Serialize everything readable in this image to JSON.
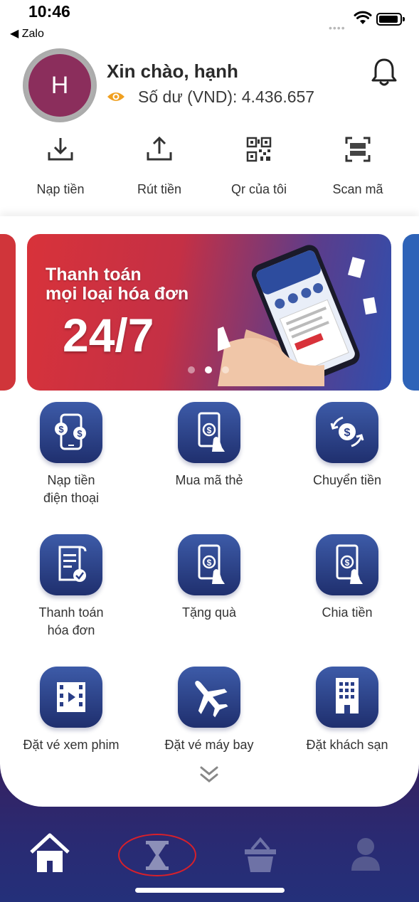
{
  "status_bar": {
    "time": "10:46",
    "back_app": "◀ Zalo",
    "signal_dots": "••••"
  },
  "profile": {
    "avatar_initial": "H",
    "greeting": "Xin chào, hạnh",
    "balance": "Số dư (VND): 4.436.657"
  },
  "quick_actions": [
    {
      "label": "Nạp tiền",
      "icon": "download-icon"
    },
    {
      "label": "Rút tiền",
      "icon": "upload-icon"
    },
    {
      "label": "Qr của tôi",
      "icon": "qr-code-icon"
    },
    {
      "label": "Scan mã",
      "icon": "scan-icon"
    }
  ],
  "banner": {
    "title_line1": "Thanh toán",
    "title_line2": "mọi loại hóa đơn",
    "big_text": "24/7",
    "active_index": 1,
    "count": 3
  },
  "services": [
    {
      "label": "Nạp tiền\nđiện thoại",
      "icon": "phone-topup-icon"
    },
    {
      "label": "Mua mã thẻ",
      "icon": "card-code-icon"
    },
    {
      "label": "Chuyển tiền",
      "icon": "transfer-icon"
    },
    {
      "label": "Thanh toán\nhóa đơn",
      "icon": "bill-icon"
    },
    {
      "label": "Tặng quà",
      "icon": "gift-money-icon"
    },
    {
      "label": "Chia tiền",
      "icon": "split-money-icon"
    },
    {
      "label": "Đặt vé xem phim",
      "icon": "movie-ticket-icon"
    },
    {
      "label": "Đặt vé máy bay",
      "icon": "airplane-icon"
    },
    {
      "label": "Đặt khách sạn",
      "icon": "hotel-icon"
    }
  ],
  "bottom_nav": [
    {
      "name": "home",
      "icon": "home-icon",
      "active": true
    },
    {
      "name": "history",
      "icon": "hourglass-icon",
      "active": false
    },
    {
      "name": "shop",
      "icon": "basket-icon",
      "active": false
    },
    {
      "name": "account",
      "icon": "user-icon",
      "active": false
    }
  ],
  "colors": {
    "service_icon_top": "#3d5ba8",
    "service_icon_bottom": "#1f2f6e",
    "banner_red": "#d8323a",
    "avatar_bg": "#8b2e5c",
    "highlight_ring": "#d8202a",
    "eye_icon": "#f0a020"
  }
}
